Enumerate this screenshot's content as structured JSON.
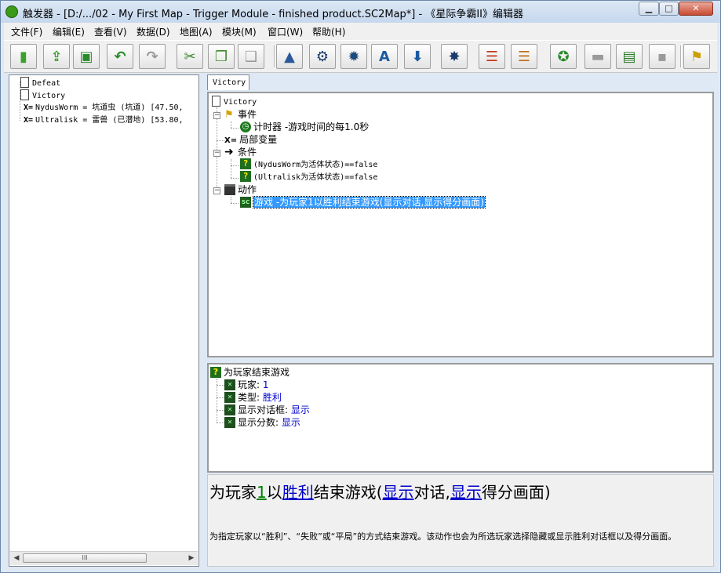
{
  "window": {
    "title": "触发器 - [D:/.../02 - My First Map - Trigger Module - finished product.SC2Map*] - 《星际争霸II》编辑器",
    "controls": {
      "minimize": "▁",
      "maximize": "□",
      "close": "✕"
    }
  },
  "menu": [
    "文件(F)",
    "编辑(E)",
    "查看(V)",
    "数据(D)",
    "地图(A)",
    "模块(M)",
    "窗口(W)",
    "帮助(H)"
  ],
  "toolbar": [
    {
      "name": "new-icon",
      "glyph": "▮",
      "color": "#3aa12a"
    },
    {
      "name": "open-icon",
      "glyph": "⇪",
      "color": "#3aa12a"
    },
    {
      "name": "save-icon",
      "glyph": "▣",
      "color": "#2a8a2a"
    },
    {
      "name": "undo-icon",
      "glyph": "↶",
      "color": "#2a8a2a"
    },
    {
      "name": "redo-icon",
      "glyph": "↷",
      "color": "#9a9a9a"
    },
    {
      "name": "cut-icon",
      "glyph": "✂",
      "color": "#3a8a2a"
    },
    {
      "name": "copy-icon",
      "glyph": "❐",
      "color": "#3a8a2a"
    },
    {
      "name": "paste-icon",
      "glyph": "❑",
      "color": "#9a9a9a"
    },
    {
      "name": "terrain-icon",
      "glyph": "▲",
      "color": "#2a5a9a"
    },
    {
      "name": "trigger-editor-icon",
      "glyph": "⚙",
      "color": "#1a3a6a"
    },
    {
      "name": "data-editor-icon",
      "glyph": "✹",
      "color": "#1a4a7a"
    },
    {
      "name": "text-editor-icon",
      "glyph": "A",
      "color": "#1a5aa0"
    },
    {
      "name": "import-icon",
      "glyph": "⬇",
      "color": "#1a5aa0"
    },
    {
      "name": "unit-icon",
      "glyph": "✸",
      "color": "#1a3a6a"
    },
    {
      "name": "layout-editor-icon",
      "glyph": "☰",
      "color": "#c23a1a"
    },
    {
      "name": "ai-editor-icon",
      "glyph": "☰",
      "color": "#c2701a"
    },
    {
      "name": "cutscene-icon",
      "glyph": "✪",
      "color": "#2a8a2a"
    },
    {
      "name": "folder-icon",
      "glyph": "▬",
      "color": "#9a9a9a"
    },
    {
      "name": "console-icon",
      "glyph": "▤",
      "color": "#2a7a2a"
    },
    {
      "name": "blank-icon",
      "glyph": "▪",
      "color": "#9a9a9a"
    },
    {
      "name": "test-map-icon",
      "glyph": "⚑",
      "color": "#c9a000"
    }
  ],
  "left_panel": {
    "items": [
      {
        "type": "trigger",
        "label": "Defeat"
      },
      {
        "type": "trigger",
        "label": "Victory"
      },
      {
        "type": "variable",
        "label": "NydusWorm = 坑道虫 (坑道) [47.50,"
      },
      {
        "type": "variable",
        "label": "Ultralisk = 雷兽  (已潜地) [53.80,"
      }
    ],
    "scroll_thumb": "III"
  },
  "tab": {
    "label": "Victory"
  },
  "trigger_tree": {
    "root": "Victory",
    "events_label": "事件",
    "event_1": "计时器 -游戏时间的每1.0秒",
    "local_vars_label": "局部变量",
    "conditions_label": "条件",
    "condition_1": "(NydusWorm为活体状态)==false",
    "condition_2": "(Ultralisk为活体状态)==false",
    "actions_label": "动作",
    "action_1": "游戏 -为玩家1以胜利结束游戏(显示对话,显示得分画面)"
  },
  "params": {
    "title": "为玩家结束游戏",
    "rows": [
      {
        "label": "玩家:",
        "value": "1"
      },
      {
        "label": "类型:",
        "value": "胜利"
      },
      {
        "label": "显示对话框:",
        "value": "显示"
      },
      {
        "label": "显示分数:",
        "value": "显示"
      }
    ]
  },
  "description": {
    "part1": "为玩家",
    "player": "1",
    "part2": "以",
    "type": "胜利",
    "part3": "结束游戏(",
    "dialog": "显示",
    "part4": "对话,",
    "score": "显示",
    "part5": "得分画面)",
    "detail": "为指定玩家以“胜利”、“失败”或“平局”的方式结束游戏。该动作也会为所选玩家选择隐藏或显示胜利对话框以及得分画面。"
  }
}
